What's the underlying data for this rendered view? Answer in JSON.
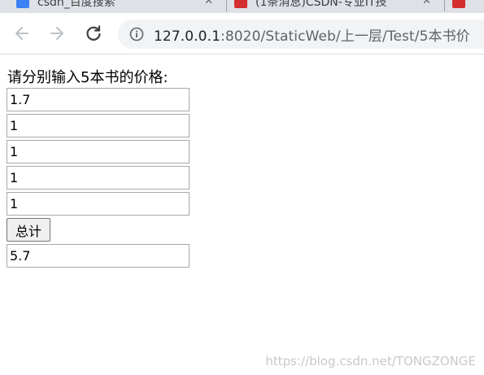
{
  "tabs": [
    {
      "title": "csdn_百度搜索",
      "close": "✕",
      "favicon_color": "#3b82f6"
    },
    {
      "title": "(1条消息)CSDN-专业IT技",
      "close": "✕",
      "favicon_color": "#d32f2f"
    },
    {
      "title": "",
      "close": "",
      "favicon_color": "#d32f2f"
    }
  ],
  "toolbar": {
    "back_icon": "arrow-left-icon",
    "forward_icon": "arrow-right-icon",
    "reload_icon": "reload-icon",
    "info_icon": "info-icon",
    "url_host": "127.0.0.1",
    "url_rest": ":8020/StaticWeb/上一层/Test/5本书价"
  },
  "page": {
    "prompt": "请分别输入5本书的价格:",
    "prices": [
      "1.7",
      "1",
      "1",
      "1",
      "1"
    ],
    "total_button_label": "总计",
    "total_value": "5.7"
  },
  "watermark": "https://blog.csdn.net/TONGZONGE"
}
